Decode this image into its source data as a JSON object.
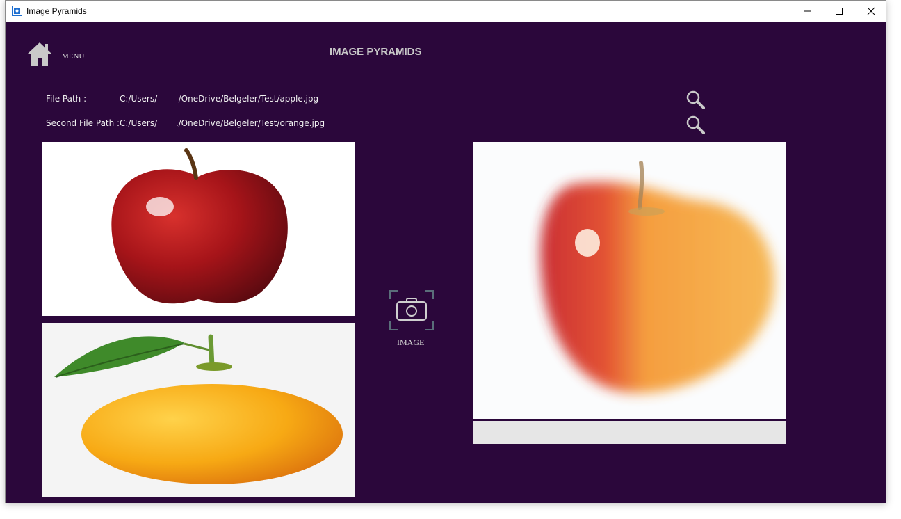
{
  "window": {
    "title": "Image Pyramids"
  },
  "header": {
    "menu_label": "MENU",
    "title": "IMAGE PYRAMIDS"
  },
  "paths": {
    "first_label": "File Path :",
    "first_value": "C:/Users/        /OneDrive/Belgeler/Test/apple.jpg",
    "second_label": "Second File Path :",
    "second_value": "C:/Users/       ./OneDrive/Belgeler/Test/orange.jpg"
  },
  "images": {
    "first": "apple image",
    "second": "orange image",
    "result": "blended apple-orange image"
  },
  "capture": {
    "label": "IMAGE"
  },
  "progress": {
    "value": 0
  },
  "icons": [
    "app-icon",
    "minimize-icon",
    "maximize-icon",
    "close-icon",
    "home-icon",
    "search-icon",
    "camera-icon"
  ],
  "colors": {
    "background": "#2b073b",
    "text": "#f0f0f0",
    "progress_track": "#e6e6e6"
  }
}
